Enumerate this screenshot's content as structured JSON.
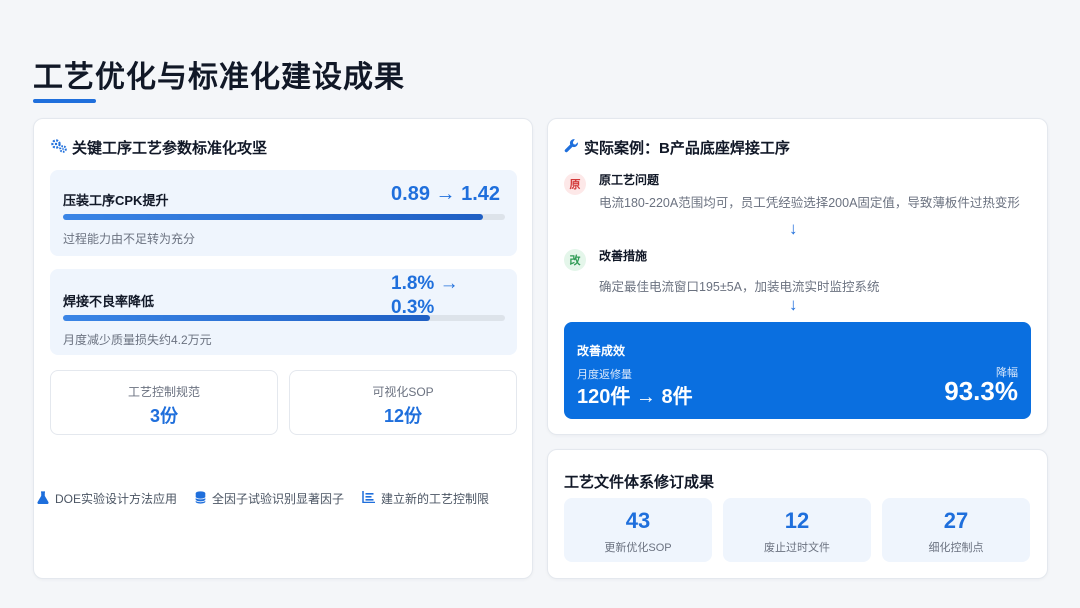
{
  "page": {
    "title": "工艺优化与标准化建设成果"
  },
  "left_panel": {
    "heading": "关键工序工艺参数标准化攻坚",
    "metrics": [
      {
        "name": "压装工序CPK提升",
        "value": "0.89 → 1.42",
        "progress": 0.95,
        "note": "过程能力由不足转为充分"
      },
      {
        "name": "焊接不良率降低",
        "value": "1.8% → 0.3%",
        "progress": 0.83,
        "note": "月度减少质量损失约4.2万元"
      }
    ],
    "stats": [
      {
        "label": "工艺控制规范",
        "value": "3份"
      },
      {
        "label": "可视化SOP",
        "value": "12份"
      }
    ],
    "methods": [
      {
        "icon": "flask-icon",
        "label": "DOE实验设计方法应用"
      },
      {
        "icon": "database-icon",
        "label": "全因子试验识别显著因子"
      },
      {
        "icon": "list-icon",
        "label": "建立新的工艺控制限"
      }
    ]
  },
  "case_panel": {
    "heading": "实际案例：B产品底座焊接工序",
    "original": {
      "badge": "原",
      "title": "原工艺问题",
      "desc": "电流180-220A范围均可，员工凭经验选择200A固定值，导致薄板件过热变形"
    },
    "improvement": {
      "badge": "改",
      "title": "改善措施",
      "desc": "确定最佳电流窗口195±5A，加装电流实时监控系统"
    },
    "result": {
      "title": "改善成效",
      "sublabel": "月度返修量",
      "value": "120件 → 8件",
      "right_label": "降幅",
      "right_value": "93.3%"
    }
  },
  "docs_panel": {
    "heading": "工艺文件体系修订成果",
    "stats": [
      {
        "value": "43",
        "label": "更新优化SOP"
      },
      {
        "value": "12",
        "label": "废止过时文件"
      },
      {
        "value": "27",
        "label": "细化控制点"
      }
    ]
  },
  "colors": {
    "accent": "#1f6fdc",
    "result_bg": "#0a6fe0",
    "metric_bg": "#eff5fd"
  }
}
